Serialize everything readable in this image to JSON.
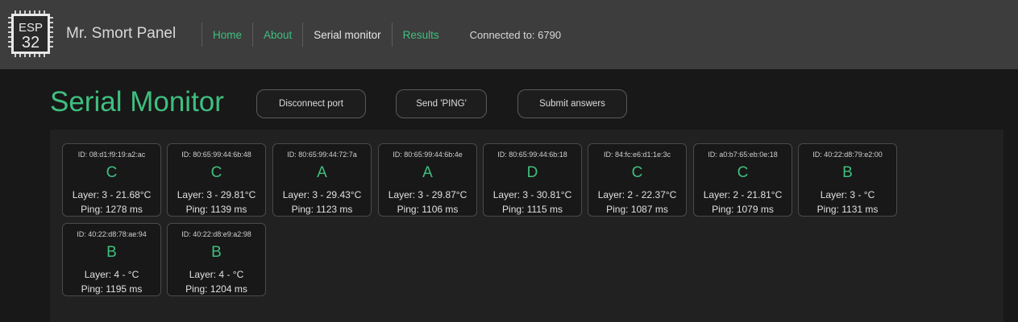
{
  "header": {
    "logo_text": "ESP 32",
    "brand": "Mr. Smort Panel",
    "nav": [
      {
        "label": "Home",
        "active": false
      },
      {
        "label": "About",
        "active": false
      },
      {
        "label": "Serial monitor",
        "active": true
      },
      {
        "label": "Results",
        "active": false
      }
    ],
    "connection": "Connected to: 6790"
  },
  "main": {
    "title": "Serial Monitor",
    "buttons": {
      "disconnect": "Disconnect port",
      "ping": "Send 'PING'",
      "submit": "Submit answers"
    },
    "devices": [
      {
        "id": "ID: 08:d1:f9:19:a2:ac",
        "answer": "C",
        "layer": "Layer: 3 - 21.68°C",
        "ping": "Ping: 1278 ms"
      },
      {
        "id": "ID: 80:65:99:44:6b:48",
        "answer": "C",
        "layer": "Layer: 3 - 29.81°C",
        "ping": "Ping: 1139 ms"
      },
      {
        "id": "ID: 80:65:99:44:72:7a",
        "answer": "A",
        "layer": "Layer: 3 - 29.43°C",
        "ping": "Ping: 1123 ms"
      },
      {
        "id": "ID: 80:65:99:44:6b:4e",
        "answer": "A",
        "layer": "Layer: 3 - 29.87°C",
        "ping": "Ping: 1106 ms"
      },
      {
        "id": "ID: 80:65:99:44:6b:18",
        "answer": "D",
        "layer": "Layer: 3 - 30.81°C",
        "ping": "Ping: 1115 ms"
      },
      {
        "id": "ID: 84:fc:e6:d1:1e:3c",
        "answer": "C",
        "layer": "Layer: 2 - 22.37°C",
        "ping": "Ping: 1087 ms"
      },
      {
        "id": "ID: a0:b7:65:eb:0e:18",
        "answer": "C",
        "layer": "Layer: 2 - 21.81°C",
        "ping": "Ping: 1079 ms"
      },
      {
        "id": "ID: 40:22:d8:79:e2:00",
        "answer": "B",
        "layer": "Layer: 3 - °C",
        "ping": "Ping: 1131 ms"
      },
      {
        "id": "ID: 40:22:d8:78:ae:94",
        "answer": "B",
        "layer": "Layer: 4 - °C",
        "ping": "Ping: 1195 ms"
      },
      {
        "id": "ID: 40:22:d8:e9:a2:98",
        "answer": "B",
        "layer": "Layer: 4 - °C",
        "ping": "Ping: 1204 ms"
      }
    ]
  },
  "colors": {
    "accent": "#3fbf7f",
    "navbar_bg": "#3d3d3d",
    "page_bg": "#181818",
    "panel_bg": "#212121"
  }
}
